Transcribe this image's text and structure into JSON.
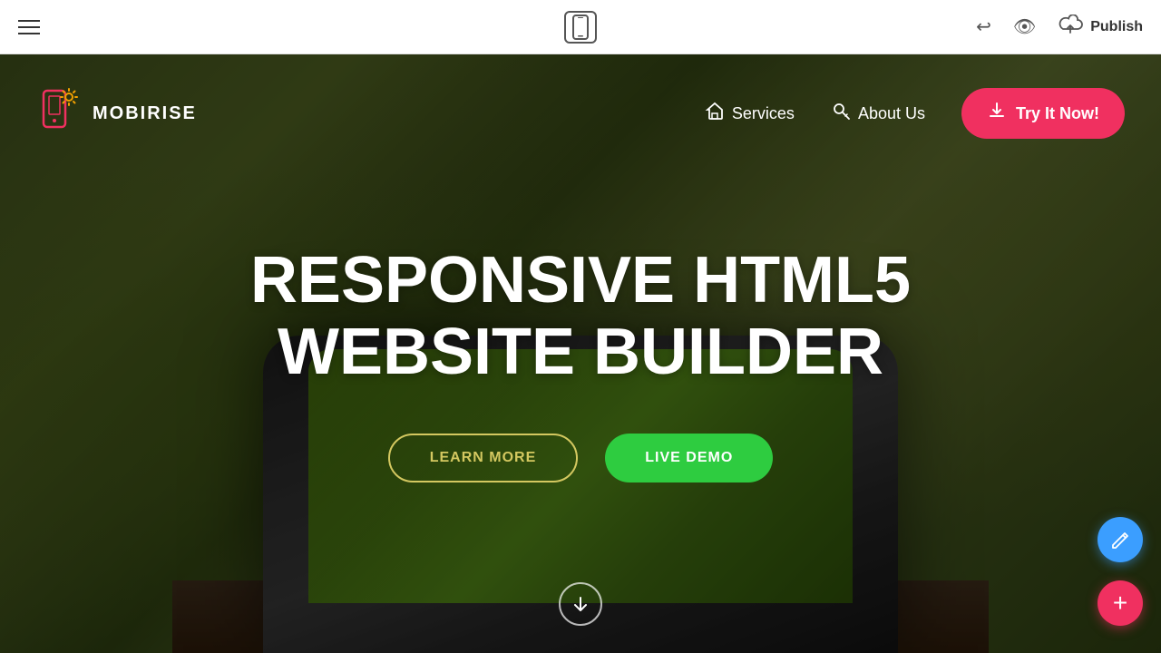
{
  "editor": {
    "publish_label": "Publish",
    "hamburger_label": "menu",
    "undo_label": "undo",
    "eye_label": "preview",
    "phone_label": "mobile-view"
  },
  "site": {
    "logo": {
      "text": "MOBIRISE"
    },
    "nav": {
      "services_label": "Services",
      "about_label": "About Us",
      "try_label": "Try It Now!"
    },
    "hero": {
      "title_line1": "RESPONSIVE HTML5",
      "title_line2": "WEBSITE BUILDER",
      "learn_more": "LEARN MORE",
      "live_demo": "LIVE DEMO"
    }
  },
  "fab": {
    "edit_label": "✏",
    "add_label": "+"
  }
}
